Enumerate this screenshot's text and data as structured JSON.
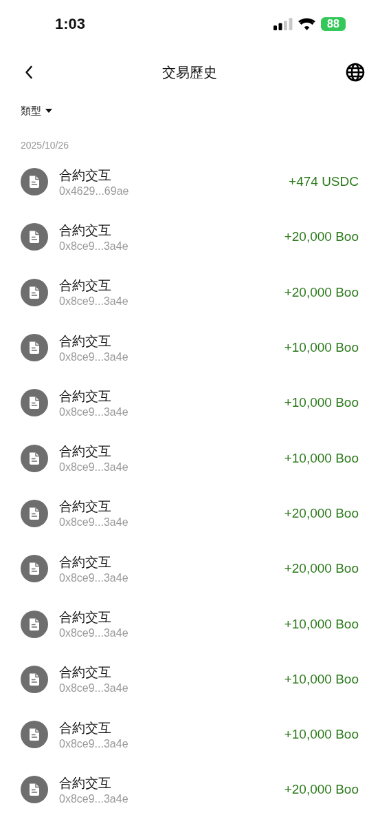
{
  "status_bar": {
    "time": "1:03",
    "battery": "88"
  },
  "header": {
    "title": "交易歷史"
  },
  "filter": {
    "label": "類型"
  },
  "date": "2025/10/26",
  "transactions": [
    {
      "title": "合約交互",
      "address": "0x4629...69ae",
      "amount": "+474 USDC"
    },
    {
      "title": "合約交互",
      "address": "0x8ce9...3a4e",
      "amount": "+20,000 Boo"
    },
    {
      "title": "合約交互",
      "address": "0x8ce9...3a4e",
      "amount": "+20,000 Boo"
    },
    {
      "title": "合約交互",
      "address": "0x8ce9...3a4e",
      "amount": "+10,000 Boo"
    },
    {
      "title": "合約交互",
      "address": "0x8ce9...3a4e",
      "amount": "+10,000 Boo"
    },
    {
      "title": "合約交互",
      "address": "0x8ce9...3a4e",
      "amount": "+10,000 Boo"
    },
    {
      "title": "合約交互",
      "address": "0x8ce9...3a4e",
      "amount": "+20,000 Boo"
    },
    {
      "title": "合約交互",
      "address": "0x8ce9...3a4e",
      "amount": "+20,000 Boo"
    },
    {
      "title": "合約交互",
      "address": "0x8ce9...3a4e",
      "amount": "+10,000 Boo"
    },
    {
      "title": "合約交互",
      "address": "0x8ce9...3a4e",
      "amount": "+10,000 Boo"
    },
    {
      "title": "合約交互",
      "address": "0x8ce9...3a4e",
      "amount": "+10,000 Boo"
    },
    {
      "title": "合約交互",
      "address": "0x8ce9...3a4e",
      "amount": "+20,000 Boo"
    }
  ]
}
